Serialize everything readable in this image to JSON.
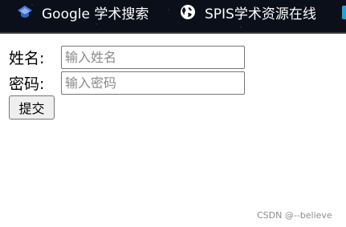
{
  "bookmarks": [
    {
      "label": "Google 学术搜索",
      "icon": "graduation-cap-icon"
    },
    {
      "label": "SPIS学术资源在线",
      "icon": "globe-icon"
    }
  ],
  "form": {
    "name_label": "姓名:",
    "name_placeholder": "输入姓名",
    "password_label": "密码:",
    "password_placeholder": "输入密码",
    "submit_label": "提交"
  },
  "watermark": "CSDN @--believe",
  "colors": {
    "bookmarks_bar_bg": "#0b0f1a",
    "google_scholar_icon": "#4a7fe0",
    "partial_bookmark_icon": "#1ea3d8"
  }
}
